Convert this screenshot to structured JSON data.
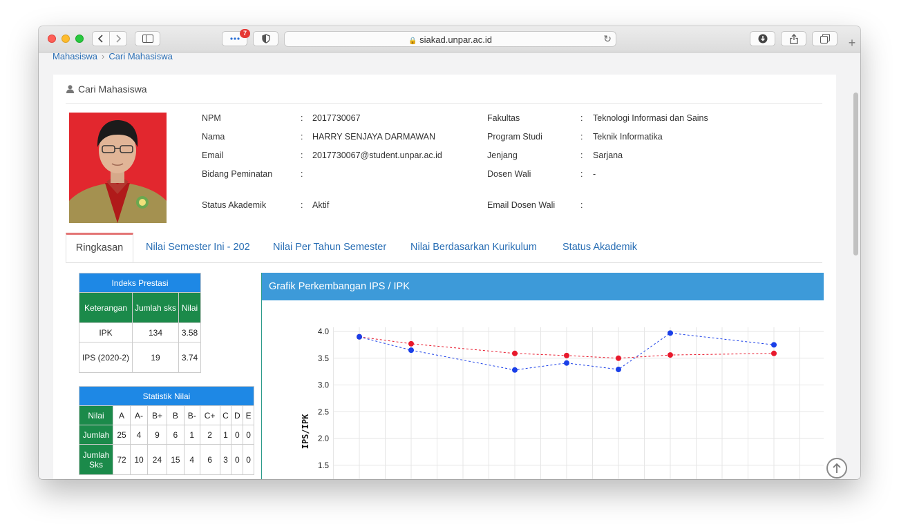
{
  "browser": {
    "url": "siakad.unpar.ac.id",
    "badge_count": "7"
  },
  "breadcrumb": [
    "Mahasiswa",
    "Cari Mahasiswa"
  ],
  "card": {
    "title": "Cari Mahasiswa"
  },
  "student": {
    "left": [
      {
        "label": "NPM",
        "value": "2017730067"
      },
      {
        "label": "Nama",
        "value": "HARRY SENJAYA DARMAWAN"
      },
      {
        "label": "Email",
        "value": "2017730067@student.unpar.ac.id"
      },
      {
        "label": "Bidang Peminatan",
        "value": ""
      },
      {
        "label": "Status Akademik",
        "value": "Aktif"
      }
    ],
    "right": [
      {
        "label": "Fakultas",
        "value": "Teknologi Informasi dan Sains"
      },
      {
        "label": "Program Studi",
        "value": "Teknik Informatika"
      },
      {
        "label": "Jenjang",
        "value": "Sarjana"
      },
      {
        "label": "Dosen Wali",
        "value": "-"
      },
      {
        "label": "Email Dosen Wali",
        "value": ""
      }
    ]
  },
  "tabs": [
    "Ringkasan",
    "Nilai Semester Ini - 202",
    "Nilai Per Tahun Semester",
    "Nilai Berdasarkan Kurikulum",
    "Status Akademik"
  ],
  "indeks_prestasi": {
    "title": "Indeks Prestasi",
    "headers": [
      "Keterangan",
      "Jumlah sks",
      "Nilai"
    ],
    "rows": [
      [
        "IPK",
        "134",
        "3.58"
      ],
      [
        "IPS (2020-2)",
        "19",
        "3.74"
      ]
    ]
  },
  "statistik_nilai": {
    "title": "Statistik Nilai",
    "grades_label": "Nilai",
    "grades": [
      "A",
      "A-",
      "B+",
      "B",
      "B-",
      "C+",
      "C",
      "D",
      "E"
    ],
    "rows": [
      {
        "label": "Jumlah",
        "values": [
          "25",
          "4",
          "9",
          "6",
          "1",
          "2",
          "1",
          "0",
          "0"
        ]
      },
      {
        "label": "Jumlah Sks",
        "values": [
          "72",
          "10",
          "24",
          "15",
          "4",
          "6",
          "3",
          "0",
          "0"
        ]
      }
    ]
  },
  "chart_header": "Grafik Perkembangan IPS / IPK",
  "chart_data": {
    "type": "line",
    "title": "Grafik Perkembangan IPS / IPK",
    "ylabel": "IPS/IPK",
    "xlabel": "",
    "ylim": [
      1.5,
      4.0
    ],
    "yticks": [
      "4.0",
      "3.5",
      "3.0",
      "2.5",
      "2.0",
      "1.5"
    ],
    "grid": true,
    "series": [
      {
        "color": "#e8192c",
        "points": [
          [
            1,
            3.9
          ],
          [
            2,
            3.77
          ],
          [
            4,
            3.59
          ],
          [
            5,
            3.55
          ],
          [
            6,
            3.5
          ],
          [
            7,
            3.56
          ],
          [
            9,
            3.59
          ]
        ]
      },
      {
        "color": "#1a3fe8",
        "points": [
          [
            1,
            3.9
          ],
          [
            2,
            3.65
          ],
          [
            4,
            3.28
          ],
          [
            5,
            3.41
          ],
          [
            6,
            3.29
          ],
          [
            7,
            3.97
          ],
          [
            9,
            3.75
          ]
        ]
      }
    ]
  }
}
